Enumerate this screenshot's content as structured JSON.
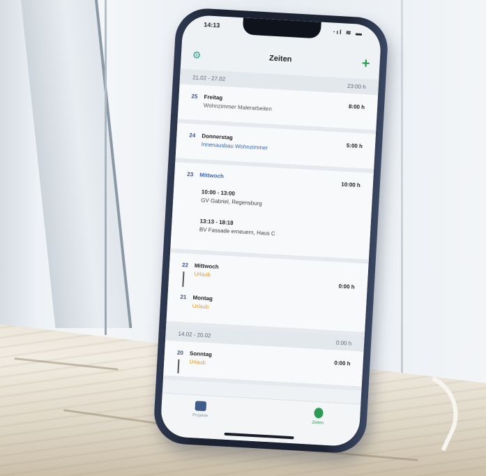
{
  "status": {
    "time": "14:13",
    "icons": "⋅ᵢₗ ≋ ▬"
  },
  "nav": {
    "title": "Zeiten",
    "add_label": "+"
  },
  "weeks": [
    {
      "range": "21.02 - 27.02",
      "total": "23:00 h",
      "days": [
        {
          "num": "25",
          "name": "Freitag",
          "sub": "Wohnzimmer Malerarbeiten",
          "hours": "8:00 h"
        },
        {
          "num": "24",
          "name": "Donnerstag",
          "sub": "Innenausbau Wohnzimmer",
          "hours": "5:00 h"
        },
        {
          "num": "23",
          "name": "Mittwoch",
          "hours": "10:00 h",
          "entries": [
            {
              "time": "10:00 - 13:00",
              "place": "GV Gabriel, Regensburg"
            },
            {
              "time": "13:13 - 18:18",
              "place": "BV Fassade erneuern, Haus C"
            }
          ]
        },
        {
          "num": "22",
          "name": "Mittwoch",
          "sub": "Urlaub",
          "hours": "0:00 h"
        },
        {
          "num": "21",
          "name": "Montag",
          "sub": "Urlaub"
        }
      ]
    },
    {
      "range": "14.02 - 20.02",
      "total": "0:00 h",
      "days": [
        {
          "num": "20",
          "name": "Sonntag",
          "sub": "Urlaub",
          "hours": "0:00 h"
        }
      ]
    }
  ],
  "tabs": {
    "projects": "Projekte",
    "times": "Zeiten"
  },
  "colors": {
    "accent_green": "#24a04a",
    "vacation_orange": "#e59a2e",
    "day_number_blue": "#3a4d9a"
  }
}
